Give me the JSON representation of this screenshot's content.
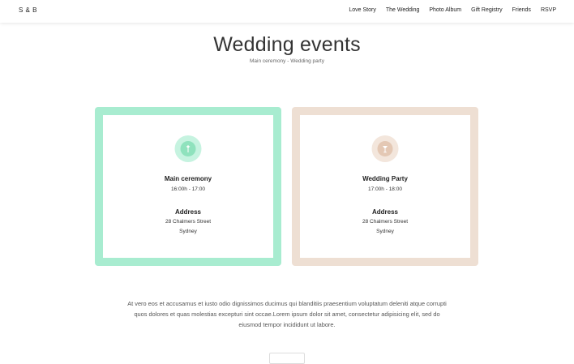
{
  "brand": "S & B",
  "nav": [
    "Love Story",
    "The Wedding",
    "Photo Album",
    "Gift Registry",
    "Friends",
    "RSVP"
  ],
  "heading": {
    "title": "Wedding events",
    "subtitle": "Main ceremony - Wedding party"
  },
  "events": [
    {
      "title": "Main ceremony",
      "time": "16:00h - 17:00",
      "address_label": "Address",
      "street": "28 Chalmers Street",
      "city": "Sydney",
      "icon": "bouquet-icon",
      "colors": {
        "frame": "#a8ecd0",
        "badge_outer": "#c6f3e0",
        "badge_inner": "#8fe2bd"
      }
    },
    {
      "title": "Wedding Party",
      "time": "17:00h - 18:00",
      "address_label": "Address",
      "street": "28 Chalmers Street",
      "city": "Sydney",
      "icon": "champagne-glass-icon",
      "colors": {
        "frame": "#eedfd3",
        "badge_outer": "#f3e6dc",
        "badge_inner": "#e4c8b4"
      }
    }
  ],
  "paragraph": "At vero eos et accusamus et iusto odio dignissimos ducimus qui blanditiis praesentium voluptatum deleniti atque corrupti quos dolores et quas molestias excepturi sint occae.Lorem ipsum dolor sit amet, consectetur adipisicing elit, sed do eiusmod tempor incididunt ut labore."
}
